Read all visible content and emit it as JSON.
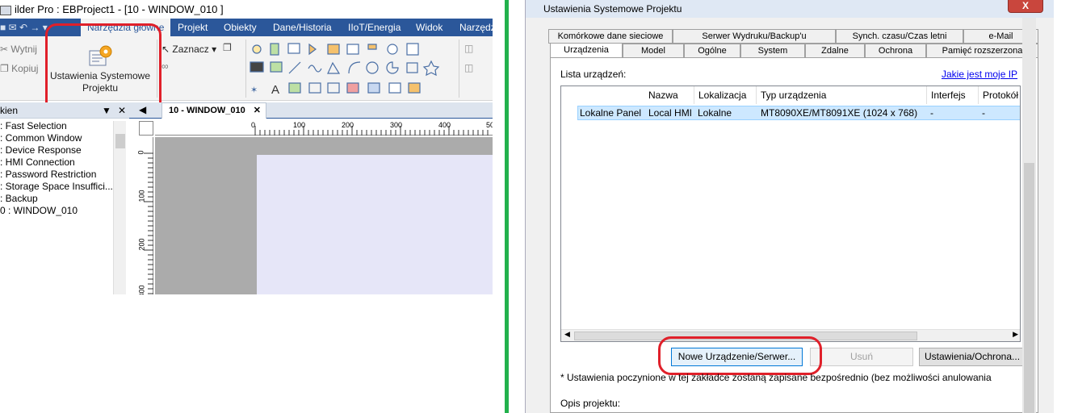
{
  "left_window": {
    "title": "ilder Pro : EBProject1 - [10 - WINDOW_010 ]",
    "menu_tabs": [
      "Narzędzia główne",
      "Projekt",
      "Obiekty",
      "Dane/Historia",
      "IIoT/Energia",
      "Widok",
      "Narzędzi"
    ],
    "ribbon": {
      "cut_label": "Wytnij",
      "copy_label": "Kopiuj",
      "settings_button_label": "Ustawienia Systemowe Projektu",
      "select_label": "Zaznacz"
    },
    "panel_header": "kien",
    "tree_items": [
      ": Fast Selection",
      ": Common Window",
      ": Device Response",
      ": HMI Connection",
      ": Password Restriction",
      ": Storage Space Insuffici...",
      ": Backup",
      "0 : WINDOW_010"
    ],
    "doc_tab": "10 - WINDOW_010",
    "ruler_h_ticks": [
      "0",
      "100",
      "200",
      "300",
      "400",
      "50"
    ],
    "ruler_v_ticks": [
      "0",
      "100",
      "200",
      "300"
    ]
  },
  "dialog": {
    "title": "Ustawienia Systemowe Projektu",
    "close_label": "X",
    "tabs_row1": [
      "Komórkowe dane sieciowe",
      "Serwer Wydruku/Backup'u",
      "Synch. czasu/Czas letni",
      "e-Mail"
    ],
    "tabs_row2": [
      "Urządzenia",
      "Model",
      "Ogólne",
      "System",
      "Zdalne",
      "Ochrona",
      "Pamięć rozszerzona"
    ],
    "list_label": "Lista urządzeń:",
    "ip_link": "Jakie jest moje IP",
    "columns": [
      "Nazwa",
      "Lokalizacja",
      "Typ urządzenia",
      "Interfejs",
      "Protokół"
    ],
    "rows": [
      {
        "name": "Lokalne Panel",
        "alias": "Local HMI",
        "location": "Lokalne",
        "type": "MT8090XE/MT8091XE (1024 x 768)",
        "interface": "-",
        "protocol": "-"
      }
    ],
    "buttons": {
      "new_device": "Nowe Urządzenie/Serwer...",
      "delete": "Usuń",
      "settings": "Ustawienia/Ochrona..."
    },
    "note": "* Ustawienia poczynione w tej zakładce zostaną zapisane bezpośrednio (bez możliwości anulowania",
    "description_label": "Opis projektu:"
  },
  "colors": {
    "accent": "#2b579a",
    "highlight_red": "#e0202a",
    "separator_green": "#22b14c",
    "selected_row": "#cde8ff"
  }
}
